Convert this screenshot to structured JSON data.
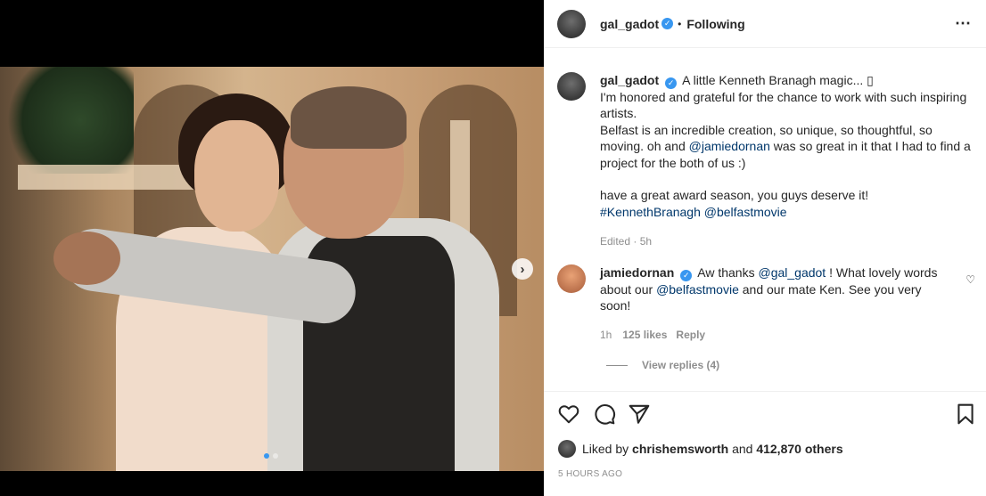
{
  "post": {
    "username": "gal_gadot",
    "follow_status": "Following",
    "separator": "•",
    "more_icon": "⋯"
  },
  "media": {
    "next_arrow": "›",
    "slides_total": 2,
    "slide_active": 1
  },
  "caption": {
    "username": "gal_gadot",
    "line1": "A little Kenneth Branagh magic... ▯",
    "line2": "I'm honored and grateful for the chance to work with such inspiring artists.",
    "line3a": "Belfast is an incredible creation, so unique, so thoughtful, so moving. oh and ",
    "mention1": "@jamiedornan",
    "line3b": " was so great in it that I had to find a project for the both of us :)",
    "line4": "have a great award season, you guys deserve it!",
    "hashtag": "#KennethBranagh",
    "mention2": "@belfastmovie",
    "edited": "Edited · 5h"
  },
  "comment": {
    "username": "jamiedornan",
    "text_a": "Aw thanks ",
    "mention1": "@gal_gadot",
    "text_b": " ! What lovely words about our ",
    "mention2": "@belfastmovie",
    "text_c": " and our mate Ken. See you very soon!",
    "time": "1h",
    "likes": "125 likes",
    "reply": "Reply",
    "view_replies": "View replies (4)",
    "heart_icon": "♡"
  },
  "likes": {
    "prefix": "Liked by ",
    "user": "chrishemsworth",
    "middle": " and ",
    "count": "412,870 others"
  },
  "timestamp": "5 HOURS AGO",
  "colors": {
    "verified": "#3897f0",
    "link": "#00376b",
    "muted": "#8e8e8e"
  }
}
